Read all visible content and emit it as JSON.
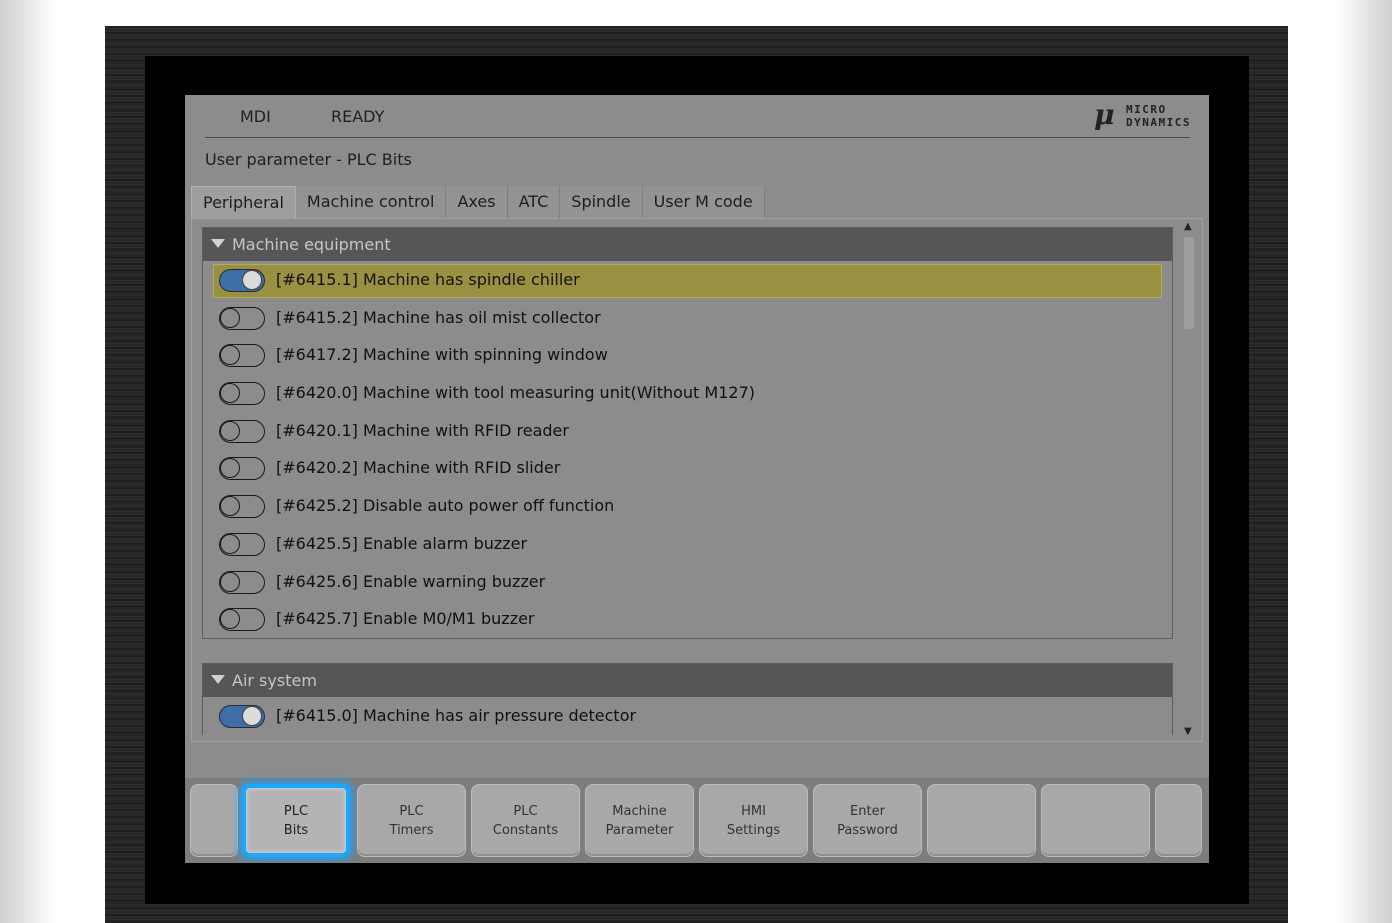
{
  "status": {
    "mode": "MDI",
    "state": "READY",
    "logo": {
      "symbol": "μ",
      "line1": "MICRO",
      "line2": "DYNAMICS"
    }
  },
  "page_title": "User parameter - PLC Bits",
  "tabs": [
    {
      "label": "Peripheral",
      "active": true
    },
    {
      "label": "Machine control",
      "active": false
    },
    {
      "label": "Axes",
      "active": false
    },
    {
      "label": "ATC",
      "active": false
    },
    {
      "label": "Spindle",
      "active": false
    },
    {
      "label": "User M code",
      "active": false
    }
  ],
  "groups": [
    {
      "title": "Machine equipment",
      "items": [
        {
          "label": "[#6415.1] Machine has spindle chiller",
          "on": true,
          "highlight": true
        },
        {
          "label": "[#6415.2] Machine has oil mist collector",
          "on": false
        },
        {
          "label": "[#6417.2] Machine with spinning window",
          "on": false
        },
        {
          "label": "[#6420.0] Machine with tool measuring unit(Without M127)",
          "on": false
        },
        {
          "label": "[#6420.1] Machine with RFID reader",
          "on": false
        },
        {
          "label": "[#6420.2] Machine with RFID slider",
          "on": false
        },
        {
          "label": "[#6425.2] Disable auto power off function",
          "on": false
        },
        {
          "label": "[#6425.5] Enable alarm buzzer",
          "on": false
        },
        {
          "label": "[#6425.6] Enable warning buzzer",
          "on": false
        },
        {
          "label": "[#6425.7] Enable M0/M1 buzzer",
          "on": false
        }
      ]
    },
    {
      "title": "Air system",
      "items": [
        {
          "label": "[#6415.0] Machine has air pressure detector",
          "on": true
        }
      ]
    }
  ],
  "scrollbar": {
    "up": "▲",
    "down": "▼"
  },
  "softkeys": [
    {
      "line1": "",
      "line2": ""
    },
    {
      "line1": "PLC",
      "line2": "Bits",
      "active": true
    },
    {
      "line1": "PLC",
      "line2": "Timers"
    },
    {
      "line1": "PLC",
      "line2": "Constants"
    },
    {
      "line1": "Machine",
      "line2": "Parameter"
    },
    {
      "line1": "HMI",
      "line2": "Settings"
    },
    {
      "line1": "Enter",
      "line2": "Password"
    },
    {
      "line1": "",
      "line2": ""
    },
    {
      "line1": "",
      "line2": ""
    },
    {
      "line1": "",
      "line2": ""
    }
  ]
}
